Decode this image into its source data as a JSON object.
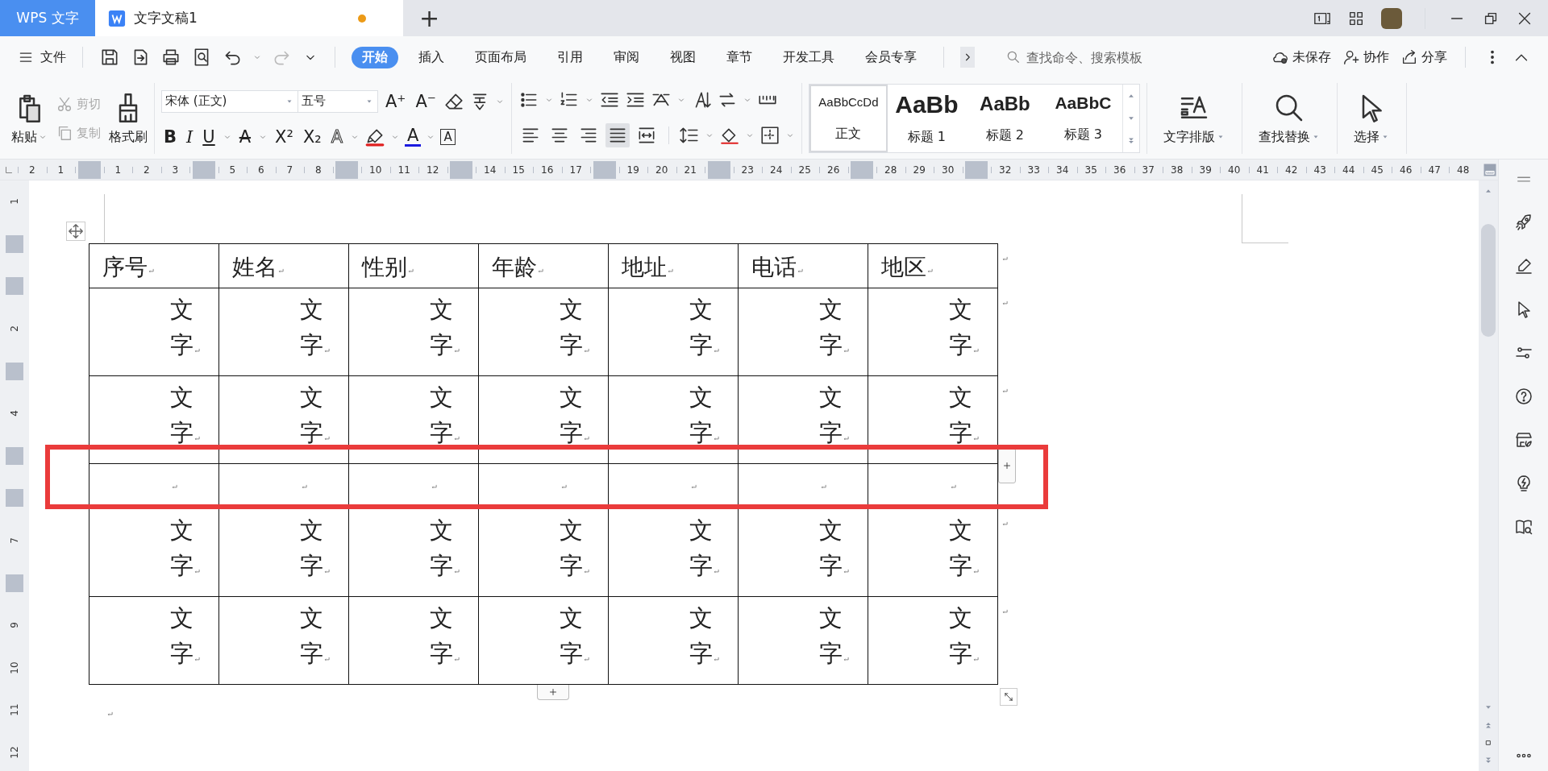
{
  "title_bar": {
    "app_tab": "WPS 文字",
    "doc_tab": {
      "title": "文字文稿1",
      "unsaved": true
    },
    "new_tab": "+"
  },
  "menu_bar": {
    "file": "文件",
    "tabs": [
      {
        "label": "开始",
        "selected": true
      },
      {
        "label": "插入",
        "selected": false
      },
      {
        "label": "页面布局",
        "selected": false
      },
      {
        "label": "引用",
        "selected": false
      },
      {
        "label": "审阅",
        "selected": false
      },
      {
        "label": "视图",
        "selected": false
      },
      {
        "label": "章节",
        "selected": false
      },
      {
        "label": "开发工具",
        "selected": false
      },
      {
        "label": "会员专享",
        "selected": false
      }
    ],
    "search": {
      "placeholder": "查找命令、搜索模板"
    },
    "save_status": "未保存",
    "collaborate": "协作",
    "share": "分享"
  },
  "ribbon": {
    "paste": "粘贴",
    "cut": {
      "label": "剪切",
      "disabled": true
    },
    "copy": {
      "label": "复制",
      "disabled": true
    },
    "format_painter": "格式刷",
    "font_name": "宋体 (正文)",
    "font_size": "五号",
    "grow_font": "A⁺",
    "shrink_font": "A⁻",
    "format_buttons": [
      {
        "kind": "bold",
        "label": "B"
      },
      {
        "kind": "italic",
        "label": "I"
      },
      {
        "kind": "underline",
        "label": "U"
      },
      {
        "kind": "strike",
        "label": "A"
      },
      {
        "kind": "sup",
        "label": "X²"
      },
      {
        "kind": "sub",
        "label": "X₂"
      },
      {
        "kind": "effect",
        "label": "A"
      },
      {
        "kind": "highlight"
      },
      {
        "kind": "color",
        "label": "A"
      },
      {
        "kind": "border",
        "label": "A"
      }
    ],
    "alignments": [
      {
        "kind": "left",
        "selected": false
      },
      {
        "kind": "center",
        "selected": false
      },
      {
        "kind": "right",
        "selected": false
      },
      {
        "kind": "justify",
        "selected": true
      },
      {
        "kind": "distributed",
        "selected": false
      }
    ],
    "styles": [
      {
        "kind": "body",
        "preview": "AaBbCcDd",
        "label": "正文",
        "selected": true
      },
      {
        "kind": "h1",
        "preview": "AaBb",
        "label": "标题 1",
        "selected": false
      },
      {
        "kind": "h2",
        "preview": "AaBb",
        "label": "标题 2",
        "selected": false
      },
      {
        "kind": "h3",
        "preview": "AaBbC",
        "label": "标题 3",
        "selected": false
      }
    ],
    "tools": [
      "文字排版",
      "查找替换",
      "选择"
    ]
  },
  "ruler": {
    "top": [
      {
        "kind": "number",
        "label": "2"
      },
      {
        "kind": "number",
        "label": "1"
      },
      {
        "kind": "marker"
      },
      {
        "kind": "number",
        "label": "1"
      },
      {
        "kind": "number",
        "label": "2"
      },
      {
        "kind": "number",
        "label": "3"
      },
      {
        "kind": "marker"
      },
      {
        "kind": "number",
        "label": "5"
      },
      {
        "kind": "number",
        "label": "6"
      },
      {
        "kind": "number",
        "label": "7"
      },
      {
        "kind": "number",
        "label": "8"
      },
      {
        "kind": "marker"
      },
      {
        "kind": "number",
        "label": "10"
      },
      {
        "kind": "number",
        "label": "11"
      },
      {
        "kind": "number",
        "label": "12"
      },
      {
        "kind": "marker"
      },
      {
        "kind": "number",
        "label": "14"
      },
      {
        "kind": "number",
        "label": "15"
      },
      {
        "kind": "number",
        "label": "16"
      },
      {
        "kind": "number",
        "label": "17"
      },
      {
        "kind": "marker"
      },
      {
        "kind": "number",
        "label": "19"
      },
      {
        "kind": "number",
        "label": "20"
      },
      {
        "kind": "number",
        "label": "21"
      },
      {
        "kind": "marker"
      },
      {
        "kind": "number",
        "label": "23"
      },
      {
        "kind": "number",
        "label": "24"
      },
      {
        "kind": "number",
        "label": "25"
      },
      {
        "kind": "number",
        "label": "26"
      },
      {
        "kind": "marker"
      },
      {
        "kind": "number",
        "label": "28"
      },
      {
        "kind": "number",
        "label": "29"
      },
      {
        "kind": "number",
        "label": "30"
      },
      {
        "kind": "marker"
      },
      {
        "kind": "number",
        "label": "32"
      },
      {
        "kind": "number",
        "label": "33"
      },
      {
        "kind": "number",
        "label": "34"
      },
      {
        "kind": "number",
        "label": "35"
      },
      {
        "kind": "number",
        "label": "36"
      },
      {
        "kind": "number",
        "label": "37"
      },
      {
        "kind": "number",
        "label": "38"
      },
      {
        "kind": "number",
        "label": "39"
      },
      {
        "kind": "number",
        "label": "40"
      },
      {
        "kind": "number",
        "label": "41"
      },
      {
        "kind": "number",
        "label": "42"
      },
      {
        "kind": "number",
        "label": "43"
      },
      {
        "kind": "number",
        "label": "44"
      },
      {
        "kind": "number",
        "label": "45"
      },
      {
        "kind": "number",
        "label": "46"
      },
      {
        "kind": "number",
        "label": "47"
      },
      {
        "kind": "number",
        "label": "48"
      }
    ],
    "left": [
      {
        "kind": "number",
        "label": "1"
      },
      {
        "kind": "marker"
      },
      {
        "kind": "marker"
      },
      {
        "kind": "number",
        "label": "2"
      },
      {
        "kind": "marker"
      },
      {
        "kind": "number",
        "label": "4"
      },
      {
        "kind": "marker"
      },
      {
        "kind": "marker"
      },
      {
        "kind": "number",
        "label": "7"
      },
      {
        "kind": "marker"
      },
      {
        "kind": "number",
        "label": "9"
      },
      {
        "kind": "number",
        "label": "10"
      },
      {
        "kind": "number",
        "label": "11"
      },
      {
        "kind": "number",
        "label": "12"
      }
    ]
  },
  "table": {
    "columns": [
      "序号",
      "姓名",
      "性别",
      "年龄",
      "地址",
      "电话",
      "地区"
    ],
    "rows": [
      {
        "kind": "text",
        "cells": [
          "文字",
          "文字",
          "文字",
          "文字",
          "文字",
          "文字",
          "文字"
        ]
      },
      {
        "kind": "text",
        "cells": [
          "文字",
          "文字",
          "文字",
          "文字",
          "文字",
          "文字",
          "文字"
        ]
      },
      {
        "kind": "empty"
      },
      {
        "kind": "text",
        "cells": [
          "文字",
          "文字",
          "文字",
          "文字",
          "文字",
          "文字",
          "文字"
        ]
      },
      {
        "kind": "text",
        "cells": [
          "文字",
          "文字",
          "文字",
          "文字",
          "文字",
          "文字",
          "文字"
        ]
      }
    ]
  }
}
